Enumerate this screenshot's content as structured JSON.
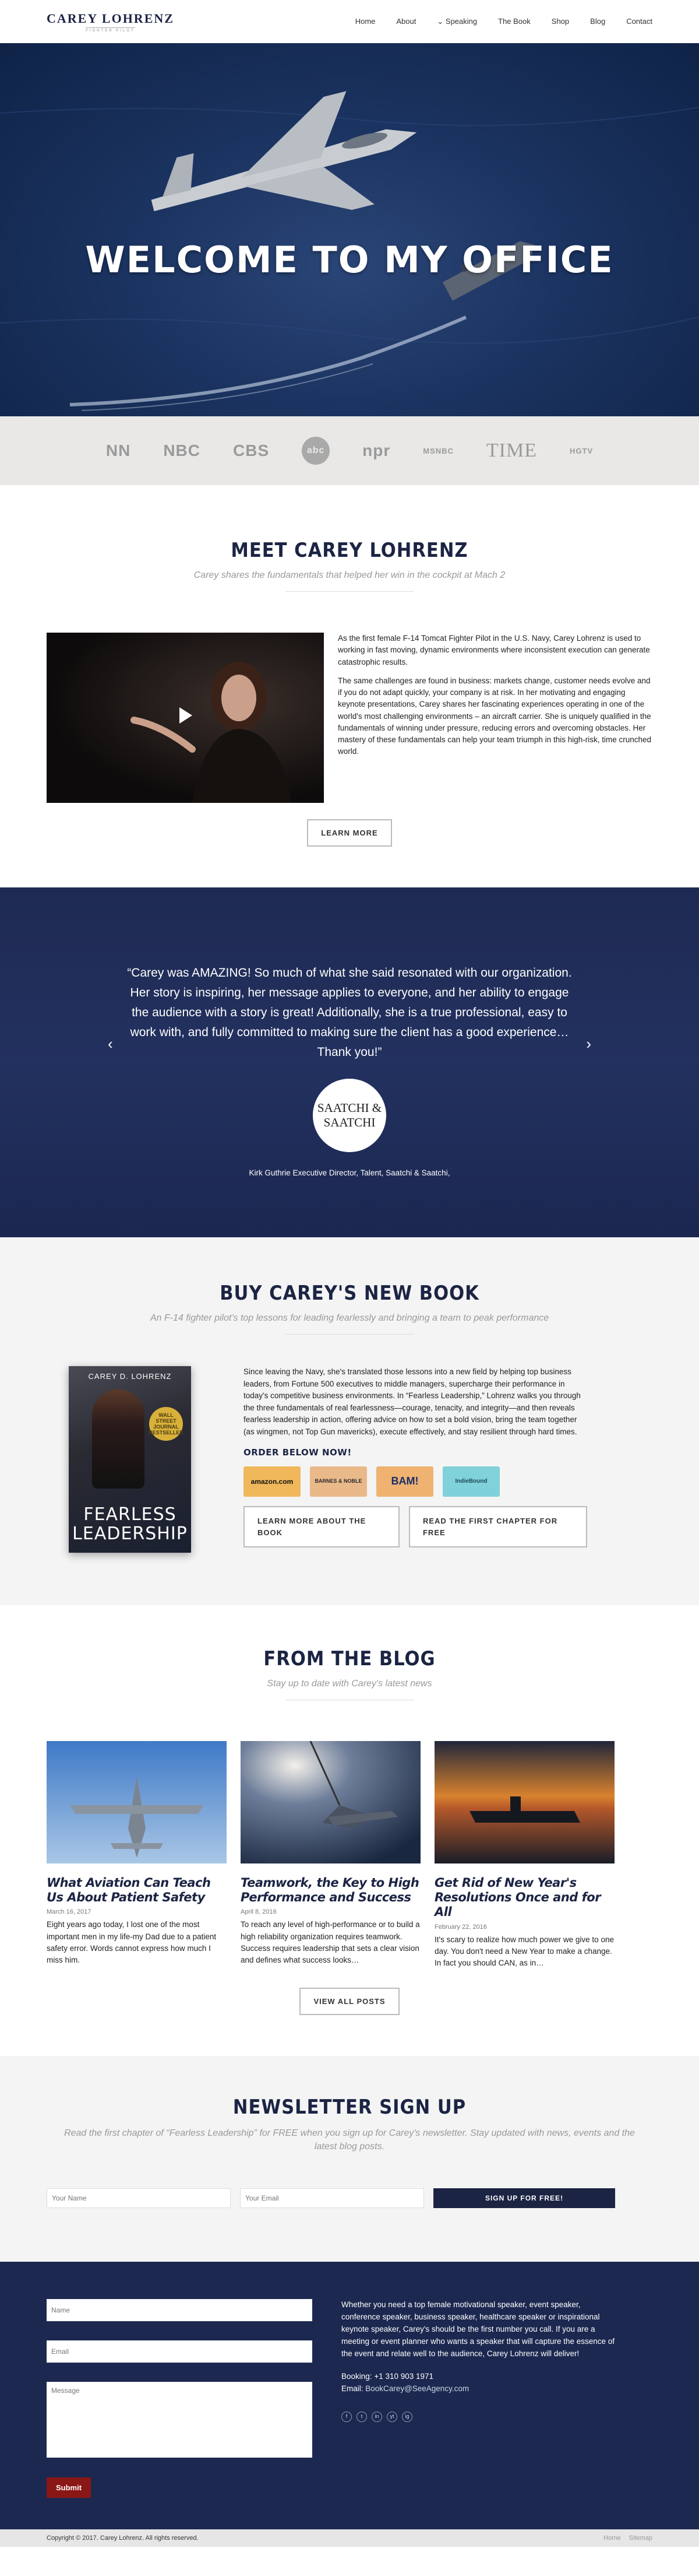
{
  "header": {
    "logo_name": "CAREY LOHRENZ",
    "logo_tag": "FIGHTER PILOT",
    "nav": [
      {
        "label": "Home"
      },
      {
        "label": "About"
      },
      {
        "label": "Speaking"
      },
      {
        "label": "The Book"
      },
      {
        "label": "Shop"
      },
      {
        "label": "Blog"
      },
      {
        "label": "Contact"
      }
    ],
    "speaking_icon": "chevron-down-icon"
  },
  "hero": {
    "title": "WELCOME TO MY OFFICE"
  },
  "press": {
    "logos": [
      "NN",
      "NBC",
      "CBS",
      "abc",
      "npr",
      "MSNBC",
      "TIME",
      "HGTV"
    ]
  },
  "meet": {
    "title": "MEET CAREY LOHRENZ",
    "subtitle": "Carey shares the fundamentals that helped her win in the cockpit at Mach 2",
    "para1": "As the first female F-14 Tomcat Fighter Pilot in the U.S. Navy, Carey Lohrenz is used to working in fast moving, dynamic environments where inconsistent execution can generate catastrophic results.",
    "para2": "The same challenges are found in business: markets change, customer needs evolve and if you do not adapt quickly, your company is at risk. In her motivating and engaging keynote presentations, Carey shares her fascinating experiences operating in one of the world's most challenging environments – an aircraft carrier. She is uniquely qualified in the fundamentals of winning under pressure, reducing errors and overcoming obstacles. Her mastery of these fundamentals can help your team triumph in this high-risk, time crunched world.",
    "button": "LEARN MORE"
  },
  "testimonial": {
    "quote": "“Carey was AMAZING! So much of what she said resonated with our organization. Her story is inspiring, her message applies to everyone, and her ability to engage the audience with a story is great! Additionally, she is a true professional, easy to work with, and fully committed to making sure the client has a good experience… Thank you!”",
    "badge_line1": "SAATCHI &",
    "badge_line2": "SAATCHI",
    "cite": "Kirk Guthrie Executive Director, Talent, Saatchi & Saatchi,",
    "prev": "‹",
    "next": "›"
  },
  "book": {
    "title": "BUY CAREY'S NEW BOOK",
    "subtitle": "An F-14 fighter pilot's top lessons for leading fearlessly and bringing a team to peak performance",
    "cover_author": "CAREY D. LOHRENZ",
    "cover_seal": "WALL STREET JOURNAL BESTSELLER",
    "cover_title_1": "FEARLESS",
    "cover_title_2": "LEADERSHIP",
    "text": "Since leaving the Navy, she's translated those lessons into a new field by helping top business leaders, from Fortune 500 executives to middle managers, supercharge their performance in today's competitive business environments. In “Fearless Leadership,” Lohrenz walks you through the three fundamentals of real fearlessness—courage, tenacity, and integrity—and then reveals fearless leadership in action, offering advice on how to set a bold vision, bring the team together (as wingmen, not Top Gun mavericks), execute effectively, and stay resilient through hard times.",
    "order_label": "ORDER BELOW NOW!",
    "retailers": [
      {
        "label": "amazon.com",
        "bg": "#f0b85a",
        "fg": "#111"
      },
      {
        "label": "BARNES & NOBLE",
        "bg": "#e9b98a",
        "fg": "#2a2a2a"
      },
      {
        "label": "BAM!",
        "bg": "#efb271",
        "fg": "#1a2d6a"
      },
      {
        "label": "IndieBound",
        "bg": "#7fd1da",
        "fg": "#1c4a55"
      }
    ],
    "button1": "LEARN MORE ABOUT THE BOOK",
    "button2": "READ THE FIRST CHAPTER FOR FREE"
  },
  "blog": {
    "title": "FROM THE BLOG",
    "subtitle": "Stay up to date with Carey's latest news",
    "posts": [
      {
        "title": "What Aviation Can Teach Us About Patient Safety",
        "date": "March 16, 2017",
        "excerpt": "Eight years ago today, I lost one of the most important men in my life-my Dad due to a patient safety error. Words cannot express how much I miss him."
      },
      {
        "title": "Teamwork, the Key to High Performance and Success",
        "date": "April 8, 2016",
        "excerpt": "To reach any level of high-performance or to build a high reliability organization requires teamwork. Success requires leadership that sets a clear vision and defines what success looks…"
      },
      {
        "title": "Get Rid of New Year's Resolutions Once and for All",
        "date": "February 22, 2016",
        "excerpt": "It's scary to realize how much power we give to one day. You don't need a New Year to make a change. In fact you should CAN, as in…"
      }
    ],
    "button": "VIEW ALL POSTS"
  },
  "newsletter": {
    "title": "NEWSLETTER SIGN UP",
    "subtitle": "Read the first chapter of “Fearless Leadership” for FREE when you sign up for Carey's newsletter. Stay updated with news, events and the latest blog posts.",
    "name_placeholder": "Your Name",
    "email_placeholder": "Your Email",
    "button": "SIGN UP FOR FREE!"
  },
  "contact": {
    "name_placeholder": "Name",
    "email_placeholder": "Email",
    "message_placeholder": "Message",
    "submit": "Submit",
    "info": "Whether you need a top female motivational speaker, event speaker, conference speaker, business speaker, healthcare speaker or inspirational keynote speaker, Carey's should be the first number you call. If you are a meeting or event planner who wants a speaker that will capture the essence of the event and relate well to the audience, Carey Lohrenz will deliver!",
    "booking_label": "Booking:",
    "booking": "+1 310 903 1971",
    "email_label": "Email:",
    "email": "BookCarey@SeeAgency.com",
    "socials": [
      "f",
      "t",
      "in",
      "yt",
      "ig"
    ]
  },
  "footer": {
    "copyright": "Copyright © 2017. Carey Lohrenz. All rights reserved.",
    "links": [
      "Home",
      "Sitemap"
    ]
  }
}
